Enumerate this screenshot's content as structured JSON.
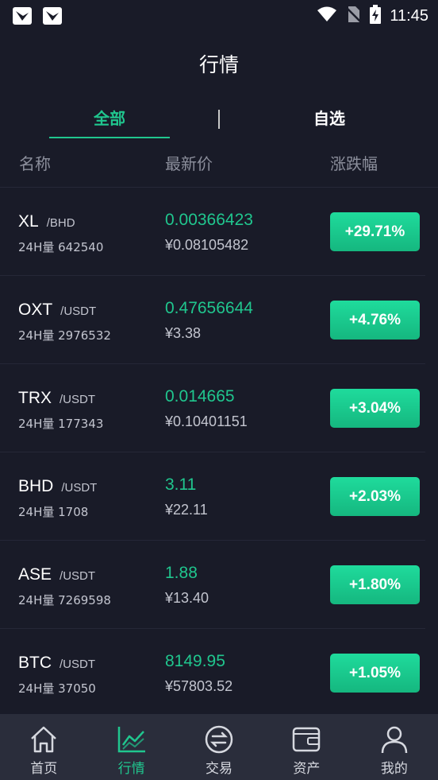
{
  "status_bar": {
    "time": "11:45",
    "icons": [
      "app-notification-icon",
      "app-notification-icon",
      "wifi-icon",
      "no-sim-icon",
      "battery-charging-icon"
    ]
  },
  "header": {
    "title": "行情"
  },
  "tabs": [
    {
      "label": "全部",
      "active": true
    },
    {
      "label": "自选",
      "active": false
    }
  ],
  "columns": {
    "name": "名称",
    "price": "最新价",
    "change": "涨跌幅"
  },
  "rows": [
    {
      "symbol": "XL",
      "quote": "/BHD",
      "volume": "24H量 642540",
      "price": "0.00366423",
      "cny": "¥0.08105482",
      "change": "+29.71%"
    },
    {
      "symbol": "OXT",
      "quote": "/USDT",
      "volume": "24H量 2976532",
      "price": "0.47656644",
      "cny": "¥3.38",
      "change": "+4.76%"
    },
    {
      "symbol": "TRX",
      "quote": "/USDT",
      "volume": "24H量 177343",
      "price": "0.014665",
      "cny": "¥0.10401151",
      "change": "+3.04%"
    },
    {
      "symbol": "BHD",
      "quote": "/USDT",
      "volume": "24H量 1708",
      "price": "3.11",
      "cny": "¥22.11",
      "change": "+2.03%"
    },
    {
      "symbol": "ASE",
      "quote": "/USDT",
      "volume": "24H量 7269598",
      "price": "1.88",
      "cny": "¥13.40",
      "change": "+1.80%"
    },
    {
      "symbol": "BTC",
      "quote": "/USDT",
      "volume": "24H量 37050",
      "price": "8149.95",
      "cny": "¥57803.52",
      "change": "+1.05%"
    }
  ],
  "bottom_nav": [
    {
      "label": "首页",
      "icon": "home-icon",
      "active": false
    },
    {
      "label": "行情",
      "icon": "chart-icon",
      "active": true
    },
    {
      "label": "交易",
      "icon": "exchange-icon",
      "active": false
    },
    {
      "label": "资产",
      "icon": "wallet-icon",
      "active": false
    },
    {
      "label": "我的",
      "icon": "profile-icon",
      "active": false
    }
  ],
  "colors": {
    "accent": "#20c68e",
    "background": "#191b28",
    "nav_background": "#2a2d3b"
  }
}
